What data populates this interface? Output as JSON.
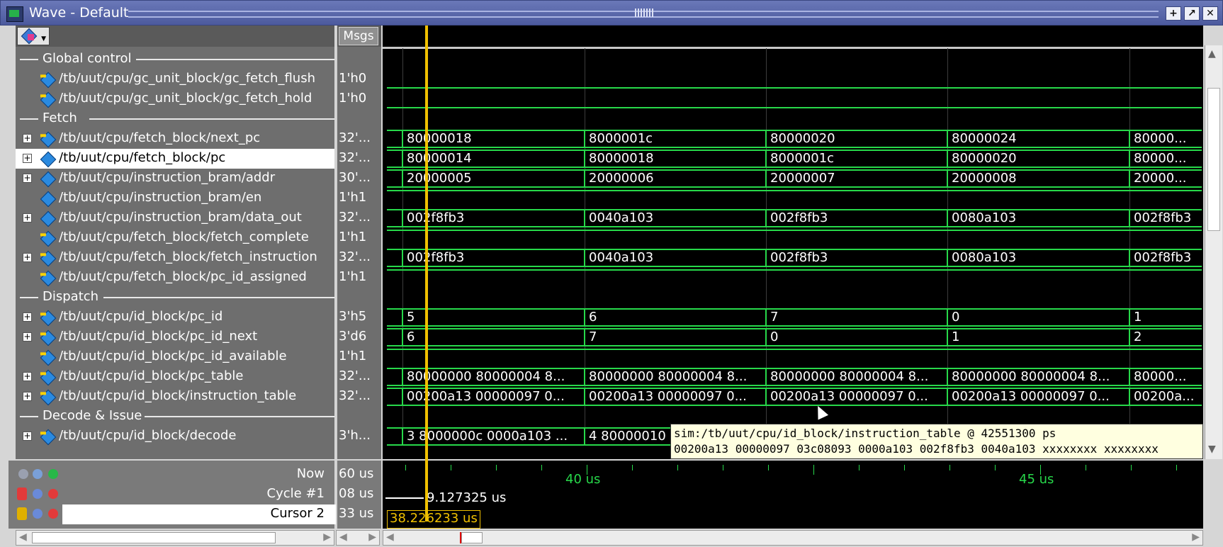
{
  "window": {
    "title": "Wave - Default",
    "buttons": [
      "+",
      "↗",
      "✕"
    ]
  },
  "msgs_header": "Msgs",
  "groups": {
    "global": "Global control",
    "fetch": "Fetch",
    "dispatch": "Dispatch",
    "decode": "Decode & Issue"
  },
  "signals": [
    {
      "path": "/tb/uut/cpu/gc_unit_block/gc_fetch_flush",
      "msg": "1'h0"
    },
    {
      "path": "/tb/uut/cpu/gc_unit_block/gc_fetch_hold",
      "msg": "1'h0"
    },
    {
      "path": "/tb/uut/cpu/fetch_block/next_pc",
      "msg": "32'..."
    },
    {
      "path": "/tb/uut/cpu/fetch_block/pc",
      "msg": "32'..."
    },
    {
      "path": "/tb/uut/cpu/instruction_bram/addr",
      "msg": "30'..."
    },
    {
      "path": "/tb/uut/cpu/instruction_bram/en",
      "msg": "1'h1"
    },
    {
      "path": "/tb/uut/cpu/instruction_bram/data_out",
      "msg": "32'..."
    },
    {
      "path": "/tb/uut/cpu/fetch_block/fetch_complete",
      "msg": "1'h1"
    },
    {
      "path": "/tb/uut/cpu/fetch_block/fetch_instruction",
      "msg": "32'..."
    },
    {
      "path": "/tb/uut/cpu/fetch_block/pc_id_assigned",
      "msg": "1'h1"
    },
    {
      "path": "/tb/uut/cpu/id_block/pc_id",
      "msg": "3'h5"
    },
    {
      "path": "/tb/uut/cpu/id_block/pc_id_next",
      "msg": "3'd6"
    },
    {
      "path": "/tb/uut/cpu/id_block/pc_id_available",
      "msg": "1'h1"
    },
    {
      "path": "/tb/uut/cpu/id_block/pc_table",
      "msg": "32'..."
    },
    {
      "path": "/tb/uut/cpu/id_block/instruction_table",
      "msg": "32'..."
    },
    {
      "path": "/tb/uut/cpu/id_block/decode",
      "msg": "3'h..."
    }
  ],
  "waves": {
    "next_pc": [
      "80000018",
      "8000001c",
      "80000020",
      "80000024",
      "80000..."
    ],
    "pc": [
      "80000014",
      "80000018",
      "8000001c",
      "80000020",
      "80000..."
    ],
    "addr": [
      "20000005",
      "20000006",
      "20000007",
      "20000008",
      "20000..."
    ],
    "data_out": [
      "002f8fb3",
      "0040a103",
      "002f8fb3",
      "0080a103",
      "002f8fb3"
    ],
    "fetch_instruction": [
      "002f8fb3",
      "0040a103",
      "002f8fb3",
      "0080a103",
      "002f8fb3"
    ],
    "pc_id": [
      "5",
      "6",
      "7",
      "0",
      "1"
    ],
    "pc_id_next": [
      "6",
      "7",
      "0",
      "1",
      "2"
    ],
    "pc_table": [
      "80000000 80000004 8...",
      "80000000 80000004 8...",
      "80000000 80000004 8...",
      "80000000 80000004 8...",
      "80000..."
    ],
    "instruction_table": [
      "00200a13 00000097 0...",
      "00200a13 00000097 0...",
      "00200a13 00000097 0...",
      "00200a13 00000097 0...",
      "00200a..."
    ],
    "decode": [
      "3 8000000c 0000a103 ...",
      "4 80000010"
    ]
  },
  "tooltip": {
    "line1": "sim:/tb/uut/cpu/id_block/instruction_table @ 42551300 ps",
    "line2": "00200a13 00000097 03c08093 0000a103 002f8fb3 0040a103 xxxxxxxx xxxxxxxx"
  },
  "bottom": {
    "now_label": "Now",
    "now_value": "60 us",
    "cycle_label": "Cycle #1",
    "cycle_value": "08 us",
    "cursor2_label": "Cursor 2",
    "cursor2_value": "33 us",
    "cycle_readout": "9.127325 us",
    "cursor2_readout": "38.226233 us",
    "timeline_labels": [
      "40 us",
      "45 us"
    ]
  },
  "colors": {
    "wave": "#27d84a",
    "cursor": "#f0c000",
    "background": "#000000"
  }
}
